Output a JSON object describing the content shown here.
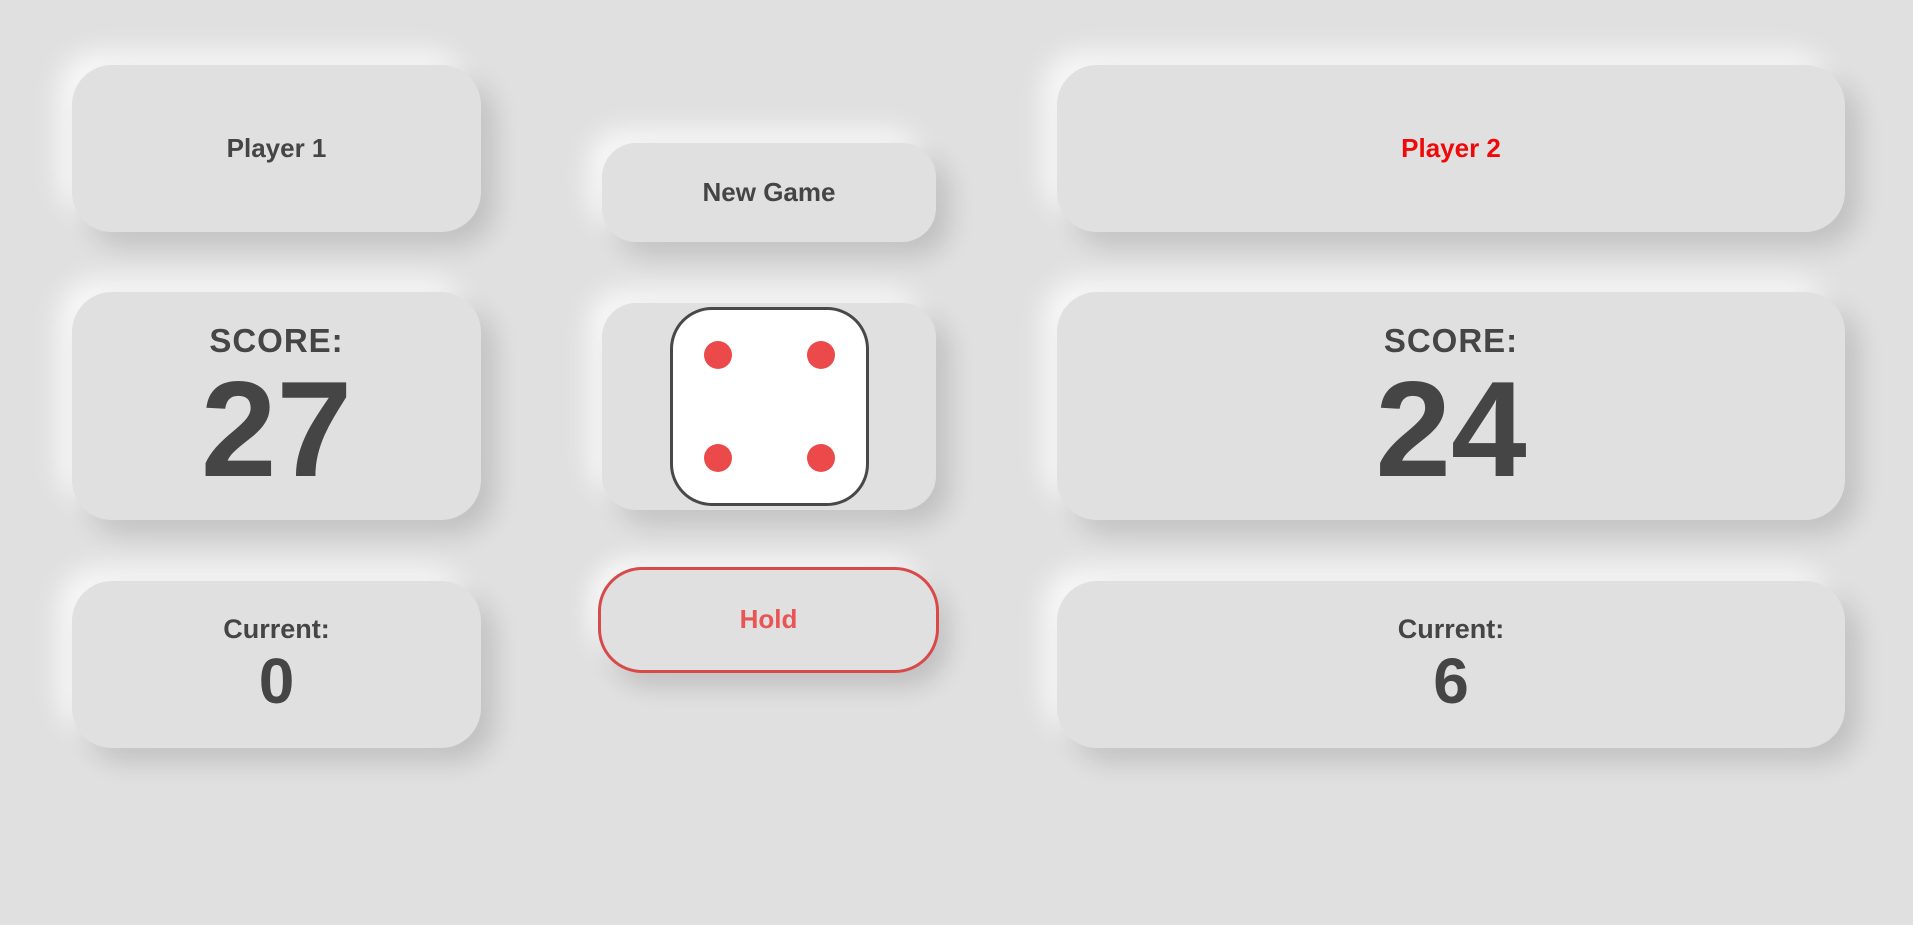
{
  "players": [
    {
      "name": "Player 1",
      "score_label": "SCORE:",
      "score": "27",
      "current_label": "Current:",
      "current": "0",
      "active": false
    },
    {
      "name": "Player 2",
      "score_label": "SCORE:",
      "score": "24",
      "current_label": "Current:",
      "current": "6",
      "active": true
    }
  ],
  "controls": {
    "new_game_label": "New Game",
    "hold_label": "Hold"
  },
  "dice": {
    "value": 4,
    "pip_color": "#ec4a4a"
  },
  "colors": {
    "background": "#e0e0e0",
    "text": "#454545",
    "active_player": "#ee0a0a",
    "hold_accent": "#d84a4a"
  }
}
